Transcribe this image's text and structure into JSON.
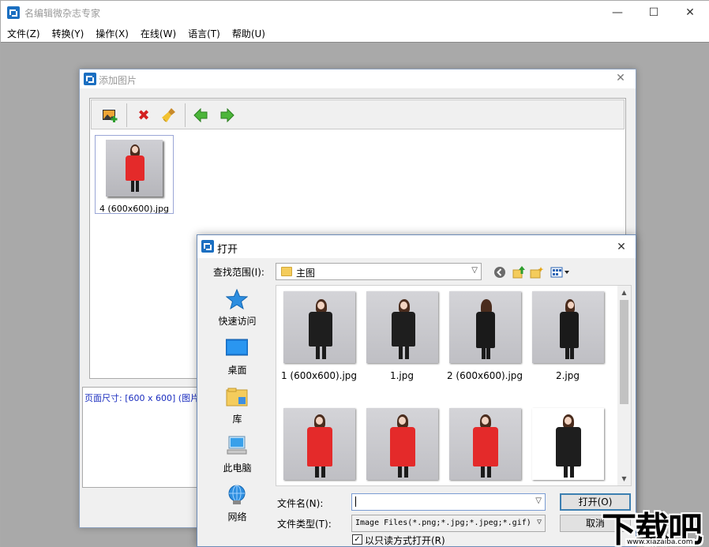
{
  "main_window": {
    "title": "名编辑微杂志专家",
    "controls": {
      "minimize": "—",
      "maximize": "☐",
      "close": "✕"
    },
    "menu": [
      "文件(Z)",
      "转换(Y)",
      "操作(X)",
      "在线(W)",
      "语言(T)",
      "帮助(U)"
    ]
  },
  "add_dialog": {
    "title": "添加图片",
    "close": "✕",
    "toolbar": {
      "add_icon": "add-image-icon",
      "delete_icon": "delete-icon",
      "clear_icon": "broom-icon",
      "left_icon": "arrow-left-icon",
      "right_icon": "arrow-right-icon"
    },
    "selected_image": {
      "caption": "4 (600x600).jpg"
    },
    "info": {
      "label": "页面尺寸:",
      "value": "[600 x 600]",
      "extra": "(图片"
    }
  },
  "open_dialog": {
    "title": "打开",
    "close": "✕",
    "look_in_label": "查找范围(I):",
    "look_in_value": "主图",
    "places": [
      {
        "label": "快速访问",
        "icon": "star-icon"
      },
      {
        "label": "桌面",
        "icon": "desktop-icon"
      },
      {
        "label": "库",
        "icon": "library-icon"
      },
      {
        "label": "此电脑",
        "icon": "computer-icon"
      },
      {
        "label": "网络",
        "icon": "network-icon"
      }
    ],
    "files": [
      {
        "name": "1 (600x600).jpg"
      },
      {
        "name": "1.jpg"
      },
      {
        "name": "2 (600x600).jpg"
      },
      {
        "name": "2.jpg"
      },
      {
        "name": ""
      },
      {
        "name": ""
      },
      {
        "name": ""
      },
      {
        "name": ""
      }
    ],
    "filename_label": "文件名(N):",
    "filename_value": "",
    "filetype_label": "文件类型(T):",
    "filetype_value": "Image Files(*.png;*.jpg;*.jpeg;*.gif)",
    "open_button": "打开(O)",
    "cancel_button": "取消",
    "readonly_label": "以只读方式打开(R)",
    "readonly_checked": "✓"
  },
  "watermark": {
    "text": "下载吧",
    "url": "www.xiazaiba.com"
  },
  "colors": {
    "accent": "#1b6fc1",
    "info_text": "#1a2dbf",
    "workarea": "#a9a9a9"
  }
}
